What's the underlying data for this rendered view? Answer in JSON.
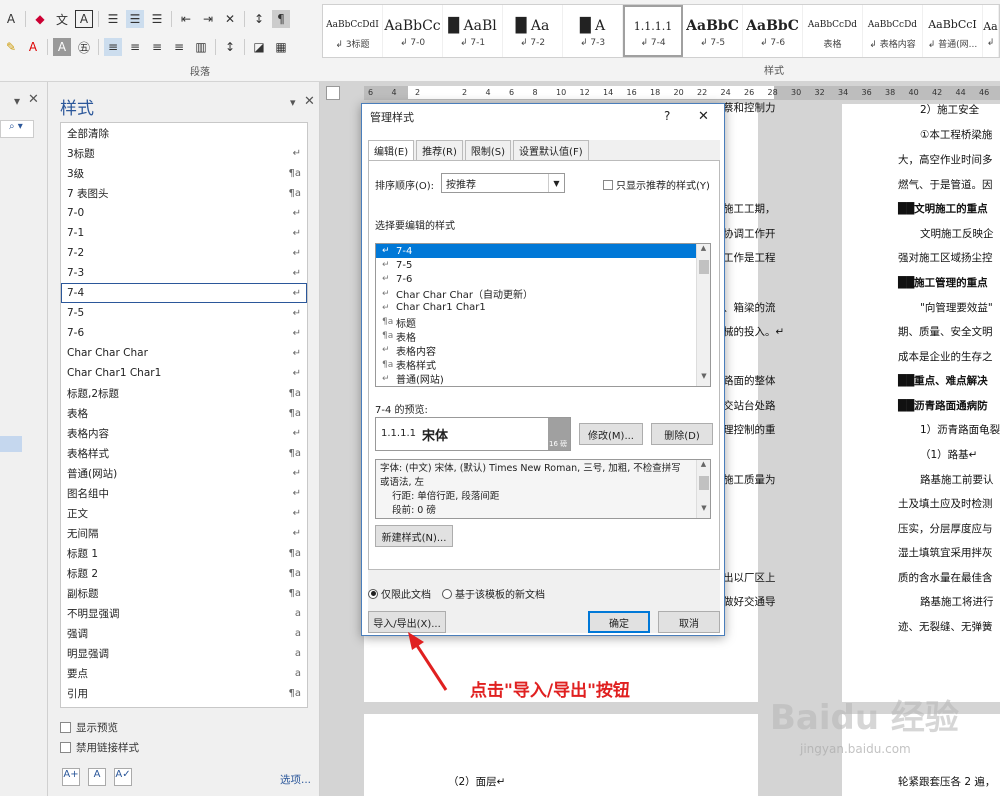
{
  "ribbon": {
    "paragraph_label": "段落",
    "styles_label": "样式",
    "gallery": [
      {
        "preview": "AaBbCcDdI",
        "name": "↲ 3标题"
      },
      {
        "preview": "AaBbCc",
        "name": "↲ 7-0"
      },
      {
        "preview": "█ AaBl",
        "name": "↲ 7-1"
      },
      {
        "preview": "█ Aa",
        "name": "↲ 7-2"
      },
      {
        "preview": "█ A",
        "name": "↲ 7-3"
      },
      {
        "preview": "1.1.1.1",
        "name": "↲ 7-4"
      },
      {
        "preview": "AaBbC",
        "name": "↲ 7-5"
      },
      {
        "preview": "AaBbC",
        "name": "↲ 7-6"
      },
      {
        "preview": "AaBbCcDd",
        "name": "表格"
      },
      {
        "preview": "AaBbCcDd",
        "name": "↲ 表格内容"
      },
      {
        "preview": "AaBbCcI",
        "name": "↲ 普通(网..."
      },
      {
        "preview": "Aa",
        "name": "↲"
      }
    ]
  },
  "styles_pane": {
    "title": "样式",
    "items": [
      {
        "label": "全部清除",
        "mark": ""
      },
      {
        "label": "3标题",
        "mark": "↵"
      },
      {
        "label": "3级",
        "mark": "¶a"
      },
      {
        "label": "7 表图头",
        "mark": "¶a"
      },
      {
        "label": "7-0",
        "mark": "↵"
      },
      {
        "label": "7-1",
        "mark": "↵"
      },
      {
        "label": "7-2",
        "mark": "↵"
      },
      {
        "label": "7-3",
        "mark": "↵"
      },
      {
        "label": "7-4",
        "mark": "↵"
      },
      {
        "label": "7-5",
        "mark": "↵"
      },
      {
        "label": "7-6",
        "mark": "↵"
      },
      {
        "label": "Char Char Char",
        "mark": "↵"
      },
      {
        "label": "Char Char1 Char1",
        "mark": "↵"
      },
      {
        "label": "标题,2标题",
        "mark": "¶a"
      },
      {
        "label": "表格",
        "mark": "¶a"
      },
      {
        "label": "表格内容",
        "mark": "↵"
      },
      {
        "label": "表格样式",
        "mark": "¶a"
      },
      {
        "label": "普通(网站)",
        "mark": "↵"
      },
      {
        "label": "图名组中",
        "mark": "↵"
      },
      {
        "label": "正文",
        "mark": "↵"
      },
      {
        "label": "无间隔",
        "mark": "↵"
      },
      {
        "label": "标题 1",
        "mark": "¶a"
      },
      {
        "label": "标题 2",
        "mark": "¶a"
      },
      {
        "label": "副标题",
        "mark": "¶a"
      },
      {
        "label": "不明显强调",
        "mark": "a"
      },
      {
        "label": "强调",
        "mark": "a"
      },
      {
        "label": "明显强调",
        "mark": "a"
      },
      {
        "label": "要点",
        "mark": "a"
      },
      {
        "label": "引用",
        "mark": "¶a"
      }
    ],
    "show_preview": "显示预览",
    "disable_linked": "禁用链接样式",
    "options_link": "选项..."
  },
  "ruler": [
    "6",
    "4",
    "2",
    "",
    "2",
    "4",
    "6",
    "8",
    "10",
    "12",
    "14",
    "16",
    "18",
    "20",
    "22",
    "24",
    "26",
    "28",
    "30",
    "32",
    "34",
    "36",
    "38",
    "40",
    "42",
    "44",
    "46",
    "48"
  ],
  "document": {
    "left_page": [
      {
        "text": "蔡和控制力"
      },
      {
        "text": "施工工期，"
      },
      {
        "text": "协调工作开"
      },
      {
        "text": "工作是工程"
      },
      {
        "text": "、箱梁的流"
      },
      {
        "text": "械的投入。↵"
      },
      {
        "text": "路面的整体"
      },
      {
        "text": "交站台处路"
      },
      {
        "text": "理控制的重"
      },
      {
        "text": "施工质量为"
      },
      {
        "text": "出以厂区上"
      },
      {
        "text": "做好交通导"
      }
    ],
    "right_page": [
      {
        "text": "2）施工安全"
      },
      {
        "text": "①本工程桥梁施"
      },
      {
        "text": "大，高空作业时间多"
      },
      {
        "text": "燃气、于是管道。因"
      },
      {
        "text": "██文明施工的重点",
        "bold": true
      },
      {
        "text": "文明施工反映企"
      },
      {
        "text": "强对施工区域扬尘控"
      },
      {
        "text": "██施工管理的重点",
        "bold": true
      },
      {
        "text": "\"向管理要效益\""
      },
      {
        "text": "期、质量、安全文明"
      },
      {
        "text": "成本是企业的生存之"
      },
      {
        "text": "██重点、难点解决",
        "bold": true
      },
      {
        "text": "██沥青路面通病防",
        "bold": true
      },
      {
        "text": "1）沥青路面龟裂"
      },
      {
        "text": "（1）路基↵"
      },
      {
        "text": "路基施工前要认"
      },
      {
        "text": "土及填土应及时检测"
      },
      {
        "text": "压实，分层厚度应与"
      },
      {
        "text": "湿土填筑宜采用拌灰"
      },
      {
        "text": "质的含水量在最佳含"
      },
      {
        "text": "路基施工将进行"
      },
      {
        "text": "迹、无裂缝、无弹簧"
      }
    ],
    "bottom_left": "（2）面层↵",
    "bottom_right": "轮紧跟套压各 2 遍，"
  },
  "dialog": {
    "title": "管理样式",
    "help": "?",
    "close": "✕",
    "tabs": [
      "编辑(E)",
      "推荐(R)",
      "限制(S)",
      "设置默认值(F)"
    ],
    "sort_label": "排序顺序(O):",
    "sort_value": "按推荐",
    "show_recommended": "只显示推荐的样式(Y)",
    "select_label": "选择要编辑的样式",
    "list": [
      {
        "mark": "↵",
        "label": "7-4",
        "selected": true
      },
      {
        "mark": "↵",
        "label": "7-5"
      },
      {
        "mark": "↵",
        "label": "7-6"
      },
      {
        "mark": "↵",
        "label": "Char Char Char（自动更新）"
      },
      {
        "mark": "↵",
        "label": "Char Char1 Char1"
      },
      {
        "mark": "¶a",
        "label": "标题"
      },
      {
        "mark": "¶a",
        "label": "表格"
      },
      {
        "mark": "↵",
        "label": "表格内容"
      },
      {
        "mark": "¶a",
        "label": "表格样式"
      },
      {
        "mark": "↵",
        "label": "普通(网站)"
      }
    ],
    "preview_label": "7-4 的预览:",
    "preview_num": "1.1.1.1",
    "preview_font": "宋体",
    "preview_size": "16 磅",
    "modify": "修改(M)...",
    "delete": "删除(D)",
    "description": [
      "字体: (中文) 宋体, (默认) Times New Roman, 三号, 加粗, 不检查拼写",
      "或语法, 左",
      "    行距: 单倍行距, 段落间距",
      "    段前: 0 磅"
    ],
    "new_style": "新建样式(N)...",
    "radio_doc": "仅限此文档",
    "radio_template": "基于该模板的新文档",
    "import_export": "导入/导出(X)...",
    "ok": "确定",
    "cancel": "取消"
  },
  "annotation": "点击\"导入/导出\"按钮",
  "watermark": "Baidu 经验",
  "watermark_sub": "jingyan.baidu.com",
  "colors": {
    "accent": "#2b579a",
    "selection": "#0078d7",
    "annotation": "#e02020"
  }
}
